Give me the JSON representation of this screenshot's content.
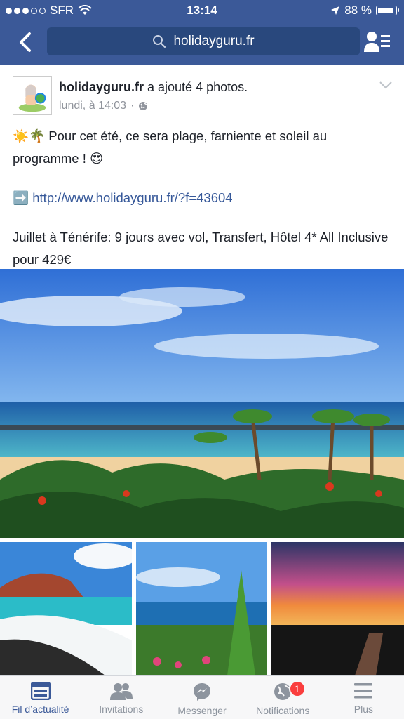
{
  "status": {
    "carrier": "SFR",
    "time": "13:14",
    "battery": "88 %",
    "battery_level": 0.88,
    "signal_bars": 3
  },
  "nav": {
    "search_text": "holidayguru.fr"
  },
  "post": {
    "author": "holidayguru.fr",
    "action": "a ajouté 4 photos.",
    "timestamp": "lundi, à 14:03",
    "line1": "Pour cet été, ce sera plage, farniente et soleil au programme !",
    "link": "http://www.holidayguru.fr/?f=43604",
    "line3": "Juillet à Ténérife: 9 jours avec vol, Transfert, Hôtel 4* All Inclusive pour 429€",
    "emoji_sun": "☀️",
    "emoji_palm": "🌴",
    "emoji_face": "😍",
    "emoji_arrow": "➡️"
  },
  "tabs": [
    {
      "label": "Fil d’actualité",
      "icon": "news-feed-icon",
      "active": true
    },
    {
      "label": "Invitations",
      "icon": "friends-icon",
      "active": false
    },
    {
      "label": "Messenger",
      "icon": "messenger-icon",
      "active": false
    },
    {
      "label": "Notifications",
      "icon": "globe-icon",
      "active": false,
      "badge": "1"
    },
    {
      "label": "Plus",
      "icon": "menu-icon",
      "active": false
    }
  ],
  "colors": {
    "brand": "#3b5998",
    "link": "#365899",
    "badge": "#fa3e3e"
  }
}
